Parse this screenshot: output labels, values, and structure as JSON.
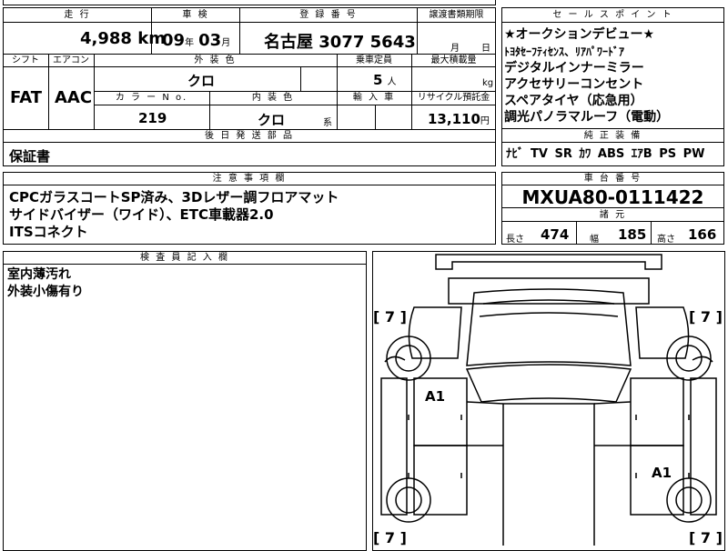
{
  "top": {
    "mileage_label": "走 行",
    "mileage_value": "4,988",
    "mileage_unit": "km",
    "inspection_label": "車 検",
    "inspection_year": "09",
    "inspection_year_unit": "年",
    "inspection_month": "03",
    "inspection_month_unit": "月",
    "registration_label": "登 録 番 号",
    "registration_place": "名古屋",
    "registration_class": "307",
    "registration_number": "7 5643",
    "transfer_label": "譲渡書類期限",
    "transfer_month_unit": "月",
    "transfer_day_unit": "日"
  },
  "specs": {
    "shift_label": "シフト",
    "aircon_label": "エアコン",
    "exterior_label": "外 装 色",
    "capacity_label": "乗車定員",
    "loadcap_label": "最大積載量",
    "shift_value": "FAT",
    "aircon_value": "AAC",
    "exterior_value": "クロ",
    "capacity_value": "5",
    "capacity_unit": "人",
    "loadcap_unit": "kg",
    "colorno_label": "カ ラ ー N o.",
    "interior_label": "内 装 色",
    "import_label": "輸 入 車",
    "recycle_label": "リサイクル預託金",
    "colorno_value": "219",
    "interior_value": "クロ",
    "interior_suffix": "系",
    "recycle_value": "13,110",
    "recycle_unit": "円"
  },
  "later_parts": {
    "label": "後 日 発 送 部 品",
    "value": "保証書"
  },
  "notes": {
    "label": "注 意 事 項 欄",
    "lines": [
      "CPCガラスコートSP済み、3Dレザー調フロアマット",
      "サイドバイザー（ワイド）、ETC車載器2.0",
      "ITSコネクト"
    ]
  },
  "inspector": {
    "label": "検 査 員 記 入 欄",
    "lines": [
      "室内薄汚れ",
      "外装小傷有り"
    ]
  },
  "sales": {
    "label": "セ ー ル ス ポ イ ン ト",
    "lines": [
      "★オークションデビュー★",
      "ﾄﾖﾀｾｰﾌﾃｨｾﾝｽ、ﾘｱﾊﾟﾜｰﾄﾞｱ",
      "デジタルインナーミラー",
      "アクセサリーコンセント",
      "スペアタイヤ（応急用）",
      "調光パノラマルーフ（電動）"
    ]
  },
  "equipment": {
    "label": "純 正 装 備",
    "value": "ﾅﾋﾞ TV SR ｶﾜ ABS ｴｱB PS PW"
  },
  "chassis": {
    "label": "車 台 番 号",
    "value": "MXUA80-0111422"
  },
  "dims": {
    "label": "諸 元",
    "length_label": "長さ",
    "length_value": "474",
    "width_label": "幅",
    "width_value": "185",
    "height_label": "高さ",
    "height_value": "166"
  },
  "diagram": {
    "tire_brackets": [
      "[ 7 ]",
      "[ 7 ]",
      "[ 7 ]",
      "[ 7 ]"
    ],
    "damage_marks": [
      "A1",
      "A1"
    ]
  }
}
